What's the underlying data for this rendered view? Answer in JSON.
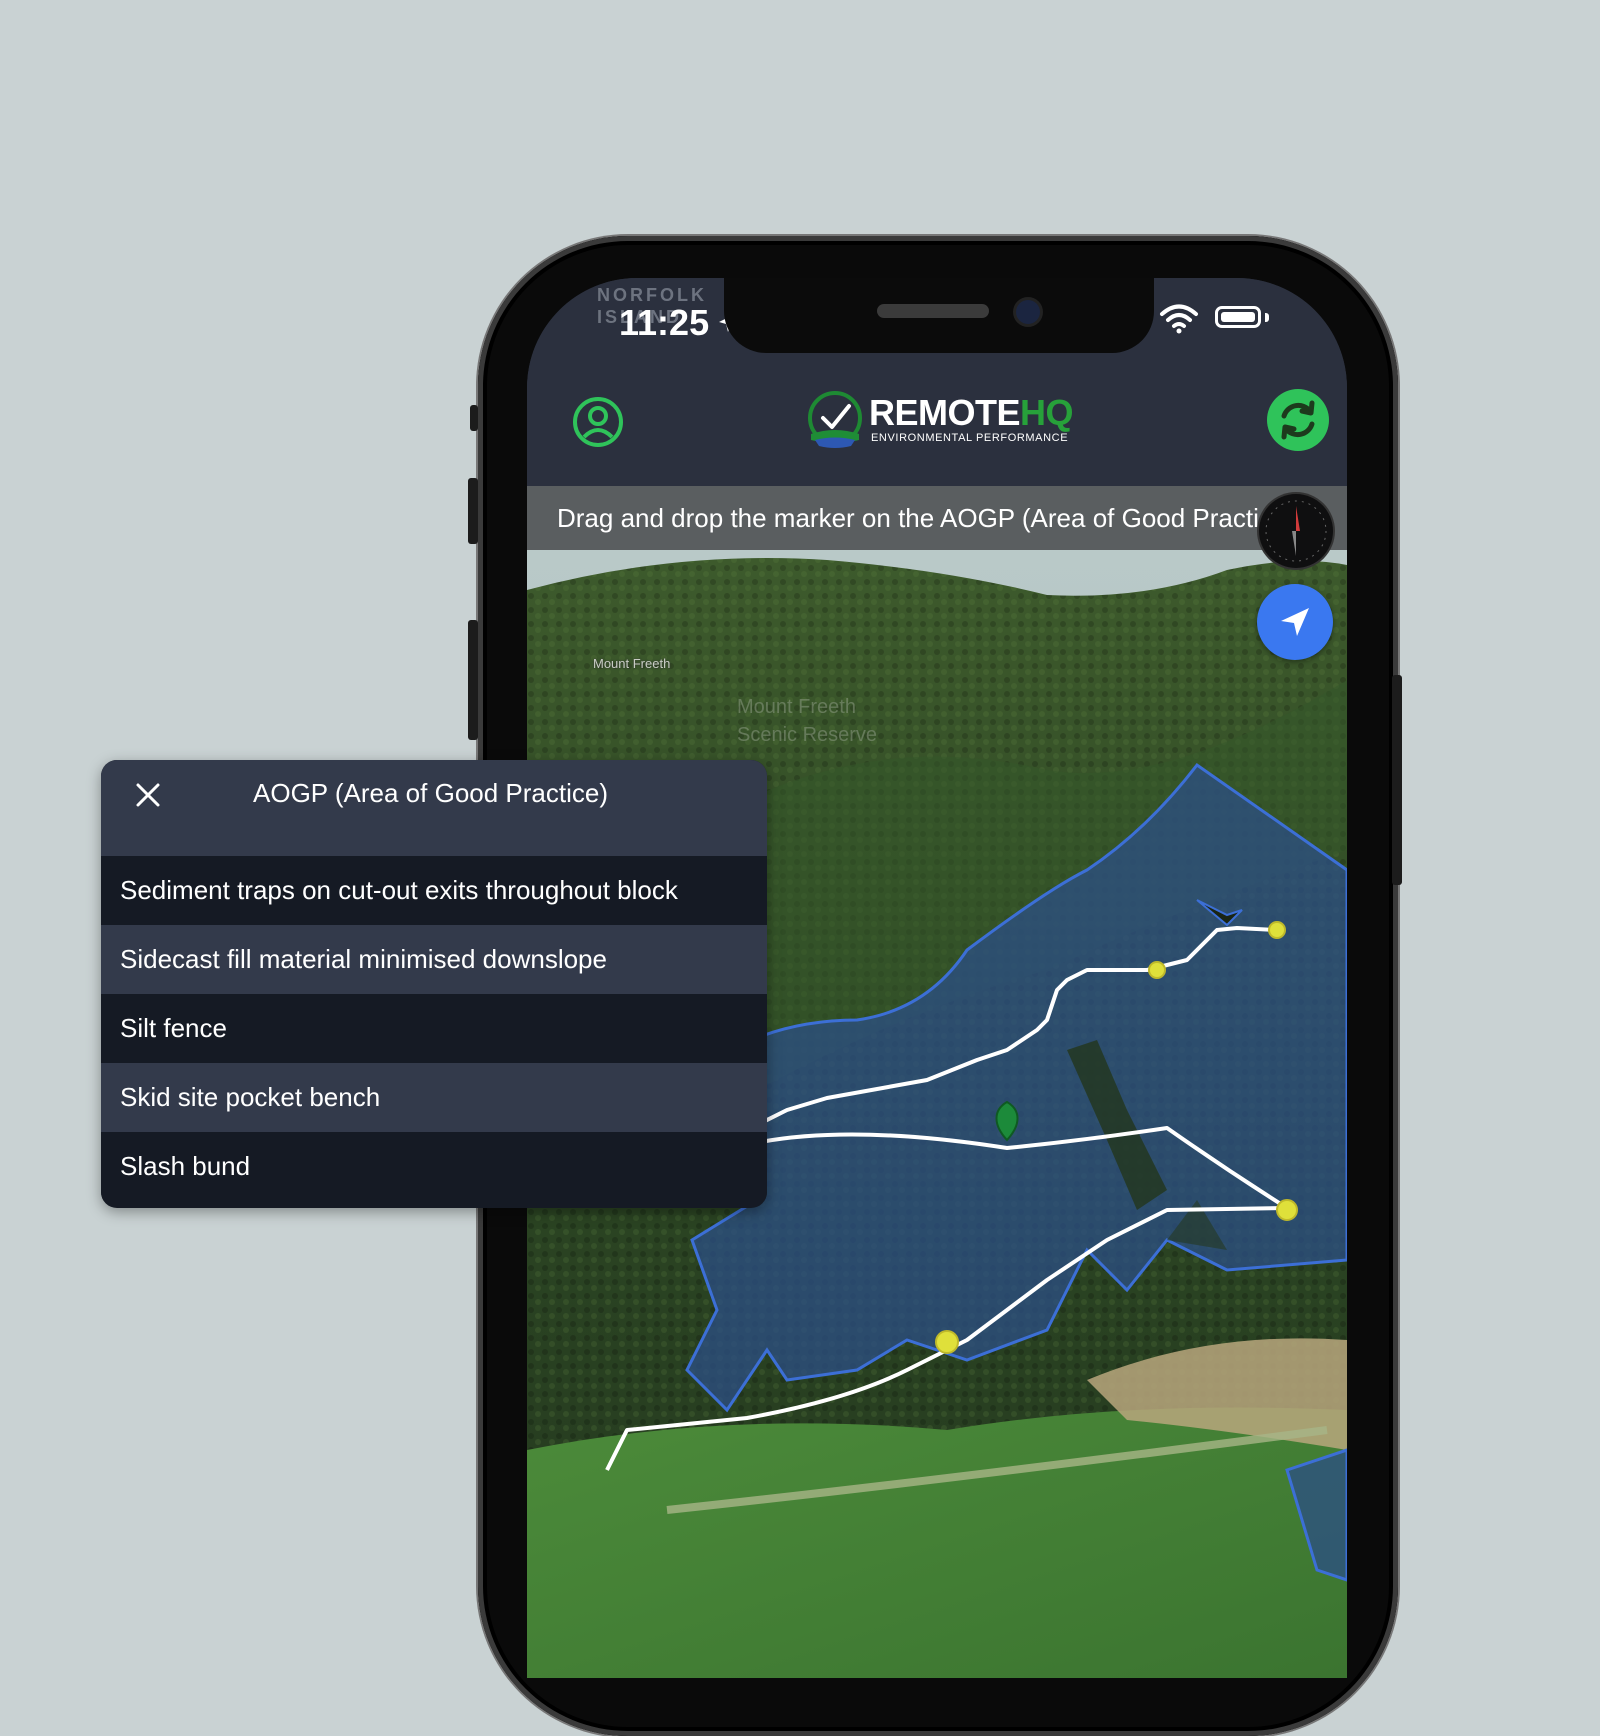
{
  "status_bar": {
    "ghost_text": "NORFOLK ISLAND",
    "time": "11:25"
  },
  "app_bar": {
    "logo_word_main": "REMOTE",
    "logo_word_accent": "HQ",
    "logo_subtitle": "ENVIRONMENTAL PERFORMANCE",
    "profile_icon": "user-circle-icon",
    "sync_icon": "sync-icon"
  },
  "banner": {
    "text": "Drag and drop the marker on the AOGP (Area of Good Practice)"
  },
  "map": {
    "labels": {
      "peak": "Mount Freeth",
      "reserve_line1": "Mount Freeth",
      "reserve_line2": "Scenic Reserve"
    },
    "locate_icon": "navigation-arrow-icon",
    "compass_icon": "compass-icon",
    "marker_icon": "map-pin-icon"
  },
  "popup": {
    "title": "AOGP (Area of Good Practice)",
    "close_icon": "close-icon",
    "items": [
      "Sediment traps on cut-out exits throughout block",
      "Sidecast fill material minimised downslope",
      "Silt fence",
      "Skid site pocket bench",
      "Slash bund"
    ]
  },
  "colors": {
    "background": "#c9d2d3",
    "app_bar": "#2b303e",
    "brand_green": "#2fc35a",
    "locate_blue": "#3a78f0",
    "popup_dark": "#151a24",
    "popup_alt": "#333a4b",
    "area_blue": "#3c6fd6"
  }
}
